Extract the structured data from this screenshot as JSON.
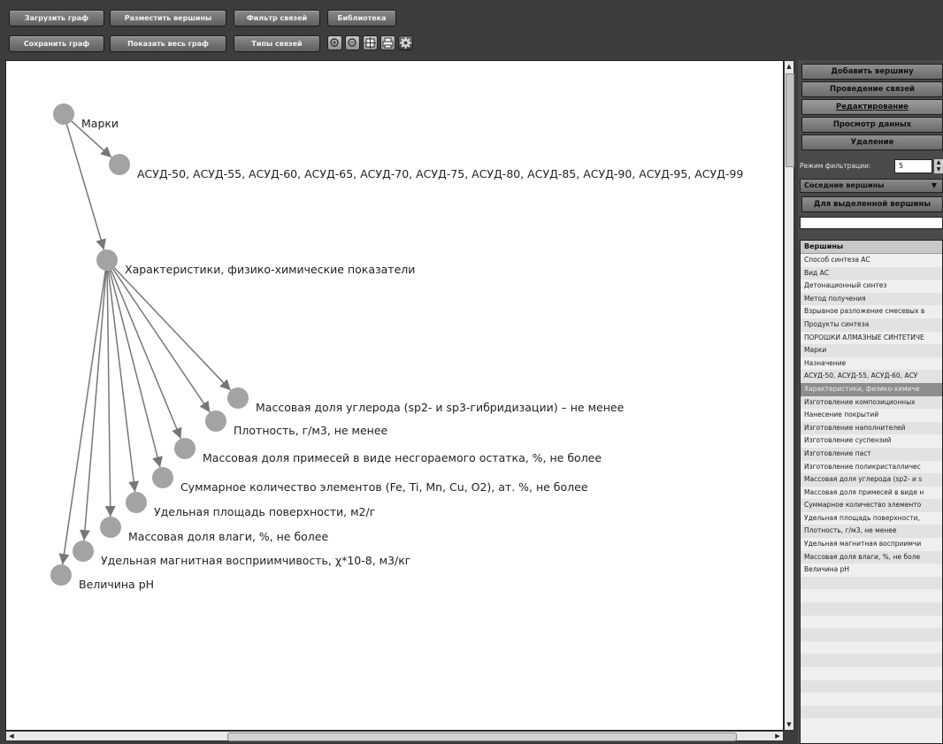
{
  "toolbar": {
    "row1": [
      "Загрузить граф",
      "Разместить вершины",
      "Фильтр связей",
      "Библиотека"
    ],
    "row2": [
      "Сохранить граф",
      "Показать весь граф",
      "Типы связей"
    ],
    "icons": [
      "zoom-in-icon",
      "zoom-out-icon",
      "fit-screen-icon",
      "print-icon",
      "settings-icon"
    ]
  },
  "graph": {
    "nodes": [
      {
        "id": "marki",
        "label": "Марки"
      },
      {
        "id": "asud",
        "label": "АСУД-50, АСУД-55, АСУД-60, АСУД-65, АСУД-70, АСУД-75, АСУД-80, АСУД-85, АСУД-90, АСУД-95, АСУД-99"
      },
      {
        "id": "harakt",
        "label": "Характеристики, физико-химические показатели"
      },
      {
        "id": "n1",
        "label": "Массовая доля углерода (sp2- и sp3-гибридизации) – не менее"
      },
      {
        "id": "n2",
        "label": "Плотность, г/м3, не менее"
      },
      {
        "id": "n3",
        "label": "Массовая доля примесей в виде несгораемого остатка, %, не более"
      },
      {
        "id": "n4",
        "label": "Суммарное количество элементов (Fe, Ti, Mn, Cu, O2), ат.  %, не более"
      },
      {
        "id": "n5",
        "label": "Удельная площадь поверхности, м2/г"
      },
      {
        "id": "n6",
        "label": "Массовая доля влаги, %, не более"
      },
      {
        "id": "n7",
        "label": "Удельная магнитная восприимчивость, χ*10-8, м3/кг"
      },
      {
        "id": "n8",
        "label": "Величина pH"
      }
    ],
    "edges": [
      [
        "marki",
        "asud"
      ],
      [
        "marki",
        "harakt"
      ],
      [
        "harakt",
        "n1"
      ],
      [
        "harakt",
        "n2"
      ],
      [
        "harakt",
        "n3"
      ],
      [
        "harakt",
        "n4"
      ],
      [
        "harakt",
        "n5"
      ],
      [
        "harakt",
        "n6"
      ],
      [
        "harakt",
        "n7"
      ],
      [
        "harakt",
        "n8"
      ]
    ]
  },
  "panel": {
    "buttons": [
      "Добавить вершину",
      "Проведение связей",
      "Редактирование",
      "Просмотр данных",
      "Удаление"
    ],
    "active_button": "Редактирование",
    "filter_label": "Режим фильтрации:",
    "filter_value": "5",
    "select_value": "Соседние вершины",
    "selected_vertex_button": "Для выделенной вершины",
    "list_header": "Вершины",
    "list_items": [
      "Способ синтеза АС",
      "Вид АС",
      "Детонационный синтез",
      "Метод получения",
      "Взрывное разложение смесевых в",
      "Продукты синтеза",
      "ПОРОШКИ АЛМАЗНЫЕ СИНТЕТИЧЕ",
      "Марки",
      "Назначение",
      "АСУД-50, АСУД-55, АСУД-60, АСУ",
      "Характеристики, физико-химиче",
      "Изготовление композиционных",
      "Нанесение покрытий",
      "Изготовление наполнителей",
      "Изготовление суспензий",
      "Изготовление паст",
      "Изготовление поликристалличес",
      "Массовая доля углерода (sp2- и s",
      "Массовая доля примесей в виде н",
      "Суммарное количество элементо",
      "Удельная площадь поверхности,",
      "Плотность, г/м3, не менее",
      "Удельная магнитная восприимчи",
      "Массовая доля влаги, %, не боле",
      "Величина pH"
    ],
    "selected_item": "Характеристики, физико-химиче"
  }
}
